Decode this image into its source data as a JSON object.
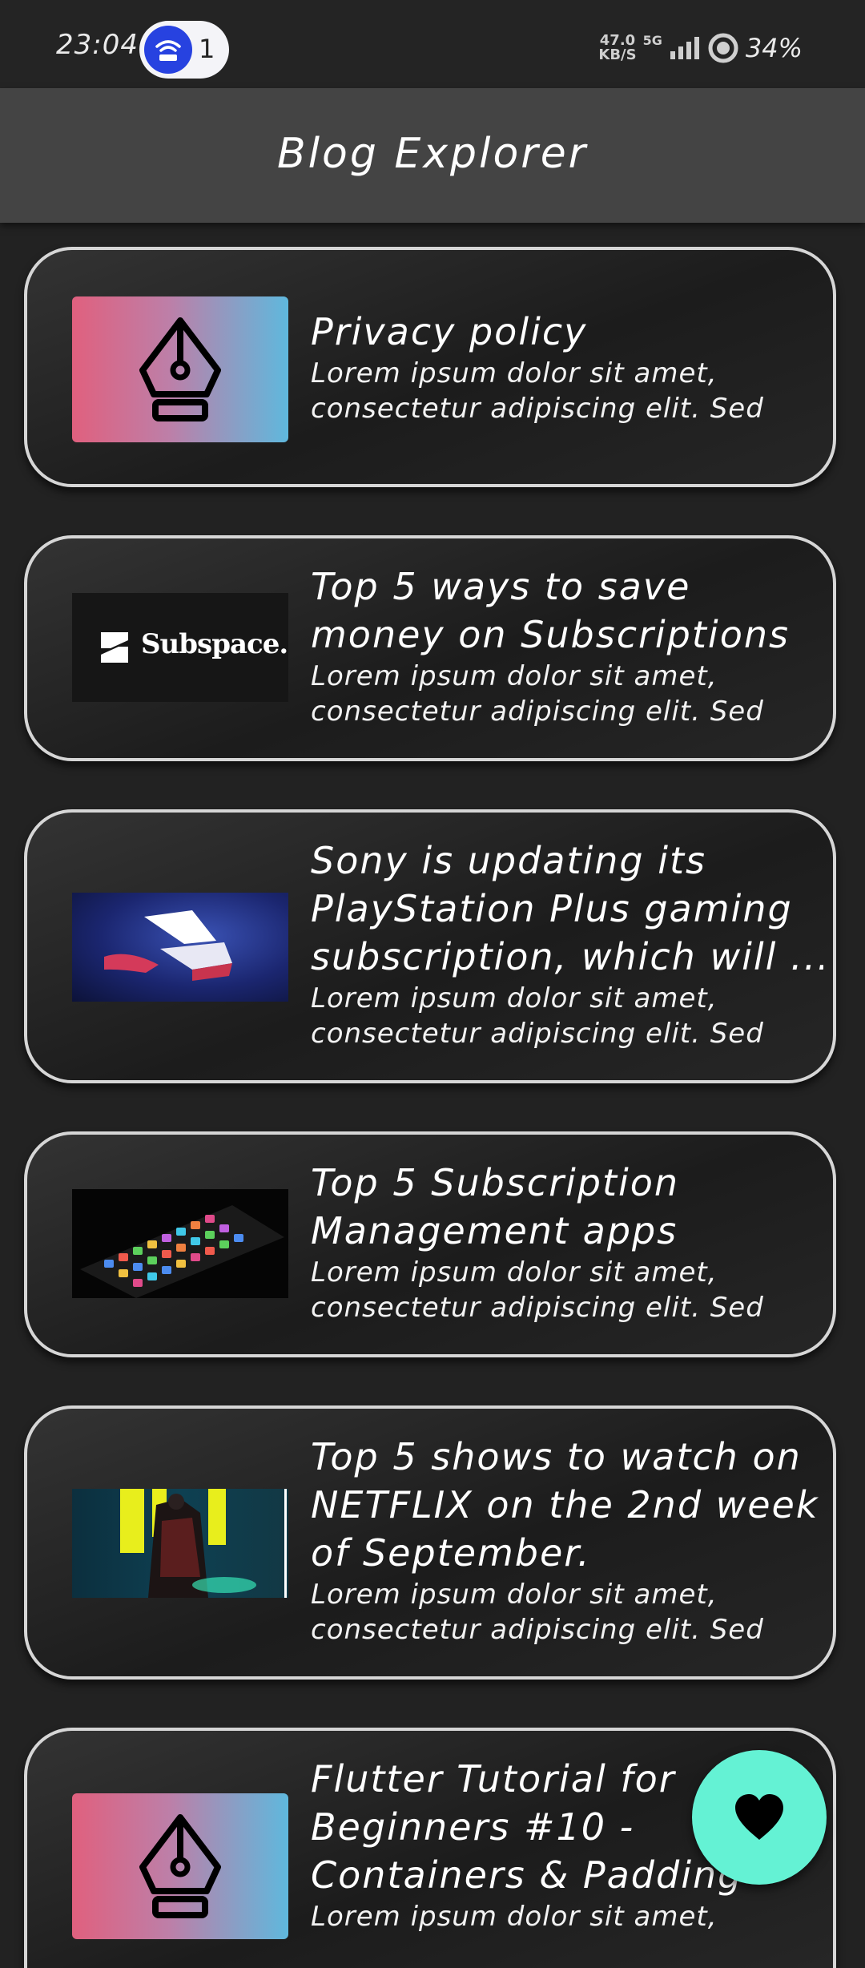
{
  "status_bar": {
    "time": "23:04",
    "hotspot_count": "1",
    "net_speed_value": "47.0",
    "net_speed_unit": "KB/S",
    "network_type": "5G",
    "battery": "34%"
  },
  "app_bar": {
    "title": "Blog Explorer"
  },
  "posts": [
    {
      "title_lines": [
        "Privacy policy"
      ],
      "desc_lines": [
        "Lorem ipsum dolor sit amet,",
        "consectetur adipiscing elit. Sed"
      ],
      "thumbnail": "pen-nib-icon"
    },
    {
      "title_lines": [
        "Top 5 ways to save",
        "money on Subscriptions"
      ],
      "desc_lines": [
        "Lorem ipsum dolor sit amet,",
        "consectetur adipiscing elit. Sed"
      ],
      "thumbnail": "subspace-logo",
      "thumb_text": "Subspace."
    },
    {
      "title_lines": [
        "Sony is updating its",
        "PlayStation Plus gaming",
        "subscription, which will ..."
      ],
      "desc_lines": [
        "Lorem ipsum dolor sit amet,",
        "consectetur adipiscing elit. Sed"
      ],
      "thumbnail": "playstation-logo"
    },
    {
      "title_lines": [
        "Top 5 Subscription",
        "Management apps"
      ],
      "desc_lines": [
        "Lorem ipsum dolor sit amet,",
        "consectetur adipiscing elit. Sed"
      ],
      "thumbnail": "smartphone-apps-photo"
    },
    {
      "title_lines": [
        "Top 5 shows to watch on",
        "NETFLIX on the 2nd week",
        "of September."
      ],
      "desc_lines": [
        "Lorem ipsum dolor sit amet,",
        "consectetur adipiscing elit. Sed"
      ],
      "thumbnail": "cyberpunk-show-art"
    },
    {
      "title_lines": [
        "Flutter Tutorial for",
        "Beginners #10 -",
        "Containers & Padding"
      ],
      "desc_lines": [
        "Lorem ipsum dolor sit amet,"
      ],
      "thumbnail": "pen-nib-icon"
    }
  ],
  "fab": {
    "icon": "heart-icon",
    "color": "#64f2d4"
  },
  "colors": {
    "background": "#222222",
    "app_bar": "#444444",
    "card_border": "#d6d6d6"
  }
}
